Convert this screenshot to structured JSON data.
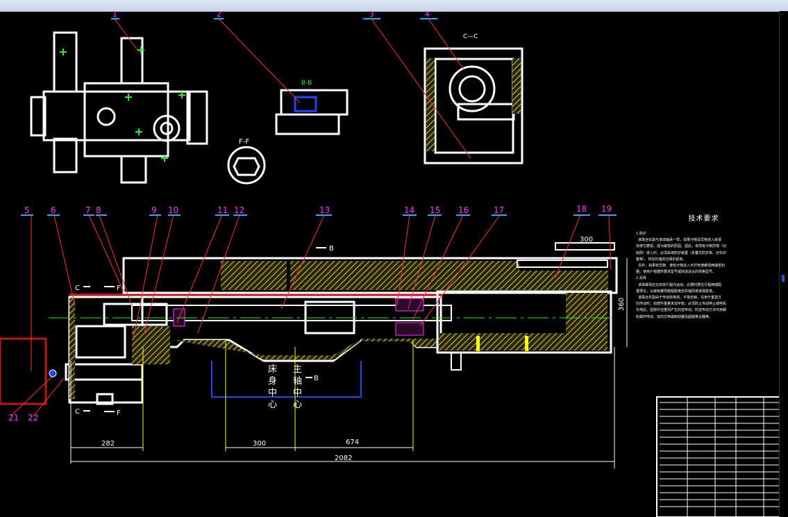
{
  "top_callouts": [
    "1",
    "2",
    "3",
    "4"
  ],
  "main_callouts": [
    "5",
    "6",
    "7",
    "8",
    "9",
    "10",
    "11",
    "12",
    "13",
    "14",
    "15",
    "16",
    "17",
    "18",
    "19"
  ],
  "bottom_callouts": [
    "21",
    "22"
  ],
  "section_labels": {
    "cc": "C—C",
    "bb": "B-B",
    "ff": "F-F"
  },
  "section_markers": {
    "b": "B",
    "c": "C",
    "f": "F"
  },
  "tech_requirements": {
    "title": "技术要求",
    "items": [
      "1.防护",
      "  滚珠丝杠副与滚动轴承一样，如果污物及异物进入就很",
      "快使它磨损，成为破损的原因。因此，考虑有污物异物（切",
      "削屑）侵入时，必须采用防护装置（折叠式防护罩、丝杠护",
      "套等），将丝杠轴完全保护起来。",
      "  另外，如果有异物、使有污物进入可拧死使螺母两端密封",
      "圈，使用户根据所要求型号或别选适合的规格型号。",
      "2.润滑",
      "  滚珠螺母应在有效行程内运动，必要时要在行程两端配",
      "置限位，以避免螺母越程脱离丝杠轴而使滚珠脱落。",
      "  滚珠丝杠副由于传动效率高，不能自锁，在用于垂直方",
      "向传动时，如部件重量未加平衡，必须防止传动停止或电机",
      "失电后，因部件自重而产生的逆传动。防逆传动方法可用蜗",
      "轮蜗杆传动、双向式电磁制动器及超越离合器等。"
    ]
  },
  "dimensions": {
    "d300_top": "300",
    "d360": "360",
    "d282": "282",
    "d300": "300",
    "d674": "674",
    "d2082": "2082"
  },
  "vertical_notes": {
    "bed_center": "床身中心",
    "spindle_center": "主轴中心"
  },
  "colors": {
    "background": "#000000",
    "outline": "#ffffff",
    "hatch": "#d8cc5a",
    "leader": "#ff3030",
    "callout": "#ff30ff",
    "dim": "#ffffff",
    "accent_green": "#22ee22",
    "accent_blue": "#2244ff",
    "accent_yellow": "#ffff00"
  }
}
